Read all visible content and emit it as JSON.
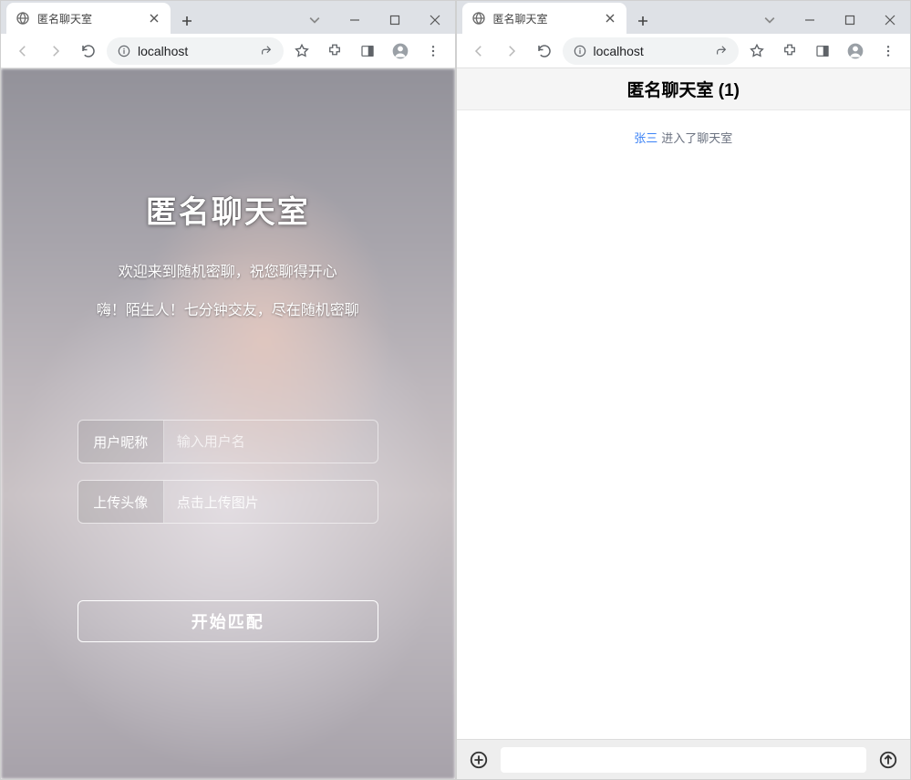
{
  "left": {
    "tab_title": "匿名聊天室",
    "address": "localhost",
    "login": {
      "title": "匿名聊天室",
      "sub1": "欢迎来到随机密聊，祝您聊得开心",
      "sub2": "嗨！陌生人！七分钟交友，尽在随机密聊",
      "nickname_label": "用户昵称",
      "nickname_placeholder": "输入用户名",
      "avatar_label": "上传头像",
      "avatar_placeholder": "点击上传图片",
      "start": "开始匹配"
    }
  },
  "right": {
    "tab_title": "匿名聊天室",
    "address": "localhost",
    "chat": {
      "header": "匿名聊天室 (1)",
      "join_name": "张三",
      "join_text": "进入了聊天室"
    }
  }
}
